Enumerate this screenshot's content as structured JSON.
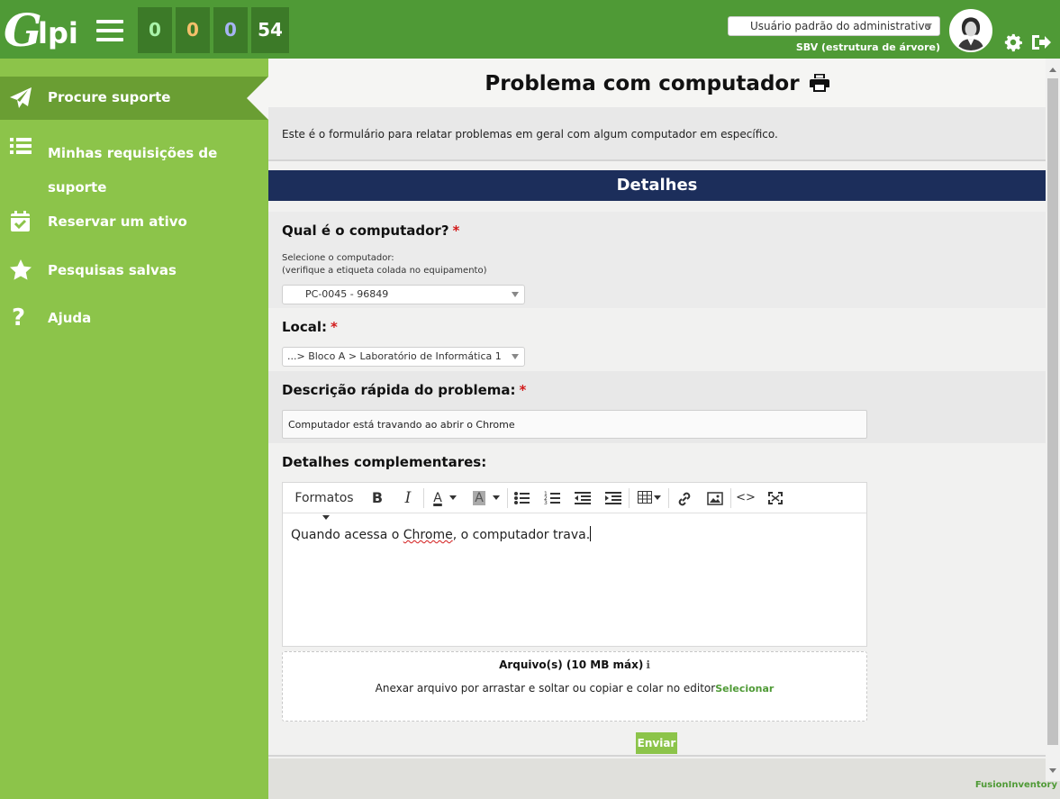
{
  "header": {
    "logo_text": "lpi",
    "logo_letter": "G",
    "counters": [
      "0",
      "0",
      "0",
      "54"
    ],
    "profile": "Usuário padrão do administrativo",
    "entity": "SBV (estrutura de árvore)"
  },
  "sidebar": {
    "items": [
      {
        "label": "Procure suporte",
        "icon": "paper-plane-icon"
      },
      {
        "label": "Minhas requisições de suporte",
        "icon": "list-icon"
      },
      {
        "label": "Reservar um ativo",
        "icon": "calendar-check-icon"
      },
      {
        "label": "Pesquisas salvas",
        "icon": "star-icon"
      },
      {
        "label": "Ajuda",
        "icon": "question-icon"
      }
    ]
  },
  "main": {
    "title": "Problema com computador",
    "description": "Este é o formulário para relatar problemas em geral com algum computador em específico.",
    "section": "Detalhes",
    "fields": {
      "computer": {
        "label": "Qual é o computador?",
        "required": "*",
        "hint_line1": "Selecione o computador:",
        "hint_line2": "(verifique a etiqueta colada no equipamento)",
        "value": "PC-0045 - 96849"
      },
      "location": {
        "label": "Local:",
        "required": "*",
        "value": "...> Bloco A > Laboratório de Informática 1"
      },
      "summary": {
        "label": "Descrição rápida do problema:",
        "required": "*",
        "value": "Computador está travando ao abrir o Chrome"
      },
      "details": {
        "label": "Detalhes complementares:",
        "toolbar_formats": "Formatos",
        "content_before": "Quando acessa o ",
        "content_misspelled": "Chrome",
        "content_after": ", o computador trava."
      }
    },
    "attachments": {
      "title": "Arquivo(s) (10 MB máx)",
      "text": "Anexar arquivo por arrastar e soltar ou copiar e colar no editor",
      "link": "Selecionar"
    },
    "submit": "Enviar"
  },
  "footer": {
    "plugin": "FusionInventory"
  },
  "colors": {
    "header_green": "#4f9a36",
    "sidebar_green": "#8cc44a",
    "section_navy": "#1c2e5b",
    "required_red": "#d21a1a"
  }
}
